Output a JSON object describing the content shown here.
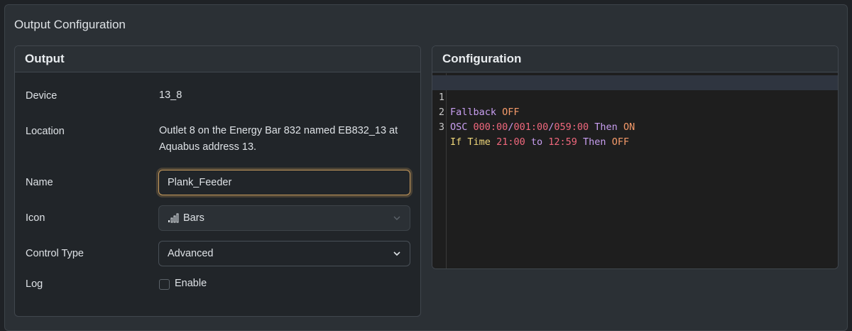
{
  "section_title": "Output Configuration",
  "output": {
    "header": "Output",
    "rows": {
      "device_label": "Device",
      "device_value": "13_8",
      "location_label": "Location",
      "location_value_line1": "Outlet 8 on the Energy Bar 832 named EB832_13 at",
      "location_value_line2": "Aquabus address 13.",
      "name_label": "Name",
      "name_value": "Plank_Feeder",
      "icon_label": "Icon",
      "icon_value": "Bars",
      "icon_glyph": "bars-icon",
      "control_type_label": "Control Type",
      "control_type_value": "Advanced",
      "log_label": "Log",
      "log_checkbox_label": "Enable",
      "log_checked": false
    }
  },
  "configuration": {
    "header": "Configuration",
    "lines": [
      {
        "n": "1",
        "t1": "Fallback",
        "t2": " ",
        "t3": "OFF"
      },
      {
        "n": "2",
        "t1": "OSC",
        "t2": " ",
        "t3": "000:00",
        "t4": "/",
        "t5": "001:00",
        "t6": "/",
        "t7": "059:00",
        "t8": " ",
        "t9": "Then",
        "t10": " ",
        "t11": "ON"
      },
      {
        "n": "3",
        "t1": "If",
        "t2": " ",
        "t3": "Time",
        "t4": " ",
        "t5": "21:00",
        "t6": " ",
        "t7": "to",
        "t8": " ",
        "t9": "12:59",
        "t10": " ",
        "t11": "Then",
        "t12": " ",
        "t13": "OFF"
      }
    ]
  }
}
